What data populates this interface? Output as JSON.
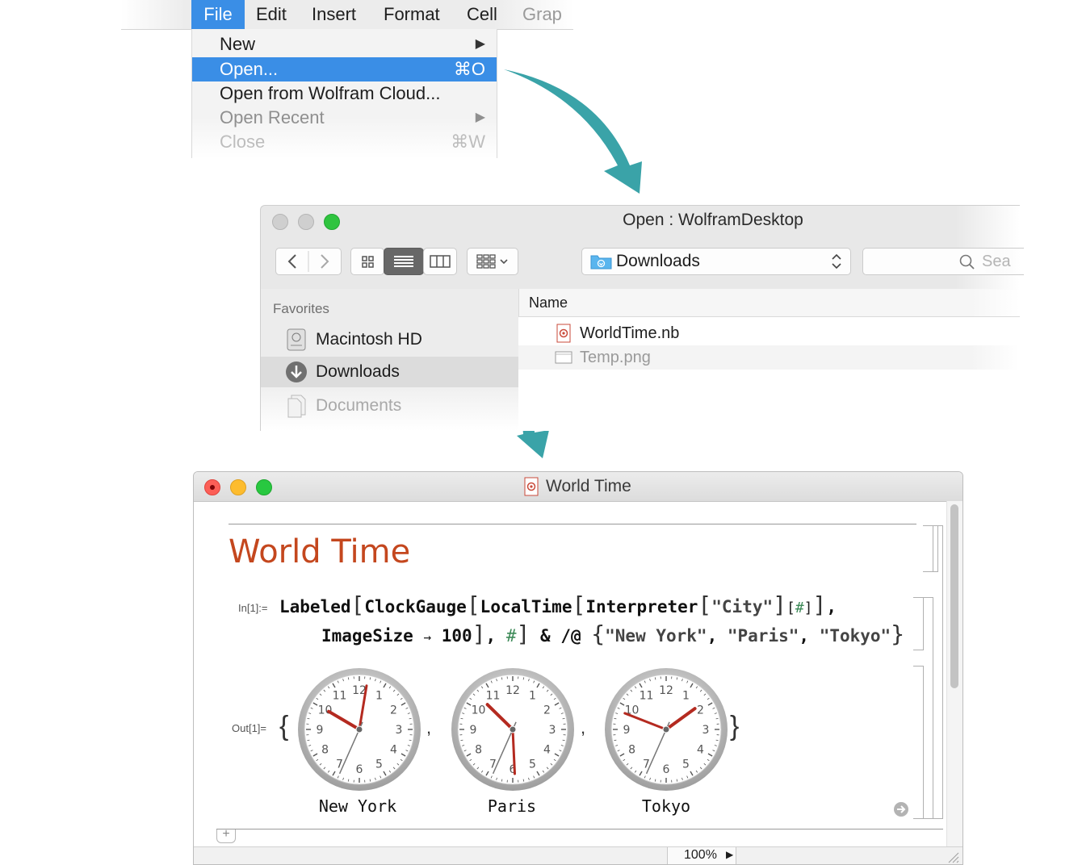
{
  "menubar": {
    "items": [
      "File",
      "Edit",
      "Insert",
      "Format",
      "Cell",
      "Grap"
    ]
  },
  "file_menu": {
    "items": [
      {
        "label": "New",
        "shortcut": "▶"
      },
      {
        "label": "Open...",
        "shortcut": "⌘O"
      },
      {
        "label": "Open from Wolfram Cloud...",
        "shortcut": ""
      },
      {
        "label": "Open Recent",
        "shortcut": "▶"
      },
      {
        "label": "Close",
        "shortcut": "⌘W"
      }
    ]
  },
  "open_dialog": {
    "title": "Open : WolframDesktop",
    "location": "Downloads",
    "search_placeholder": "Sea",
    "sidebar_heading": "Favorites",
    "sidebar_items": [
      "Macintosh HD",
      "Downloads",
      "Documents"
    ],
    "column_name": "Name",
    "files": [
      "WorldTime.nb",
      "Temp.png"
    ]
  },
  "notebook": {
    "window_title": "World Time",
    "title_cell": "World Time",
    "in_label": "In[1]:=",
    "out_label": "Out[1]=",
    "input_code": "Labeled[ClockGauge[LocalTime[Interpreter[\"City\"][#]], ImageSize → 100], #] & /@ {\"New York\", \"Paris\", \"Tokyo\"}",
    "zoom": "100%",
    "clocks": [
      {
        "city": "New York",
        "hour": 10,
        "minute": 1,
        "second": 34
      },
      {
        "city": "Paris",
        "hour": 10,
        "minute": 29,
        "second": 34
      },
      {
        "city": "Tokyo",
        "hour": 1,
        "minute": 48,
        "second": 34
      }
    ]
  },
  "colors": {
    "accent": "#3a8ee6",
    "arrow": "#3aa3a8",
    "title": "#c4471e",
    "hand": "#b42a20"
  }
}
